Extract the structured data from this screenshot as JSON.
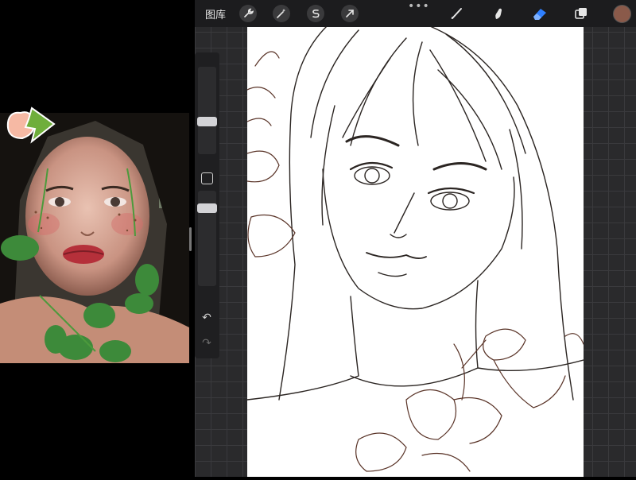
{
  "toolbar": {
    "gallery_label": "图库",
    "icons": [
      "wrench-icon",
      "magic-wand-icon",
      "selection-icon",
      "transform-arrow-icon",
      "brush-icon",
      "smudge-icon",
      "eraser-icon",
      "layers-icon"
    ],
    "more_label": "•••",
    "current_color": "#8a5a4a"
  },
  "sidebar": {
    "undo_label": "↶",
    "redo_label": "↷"
  }
}
